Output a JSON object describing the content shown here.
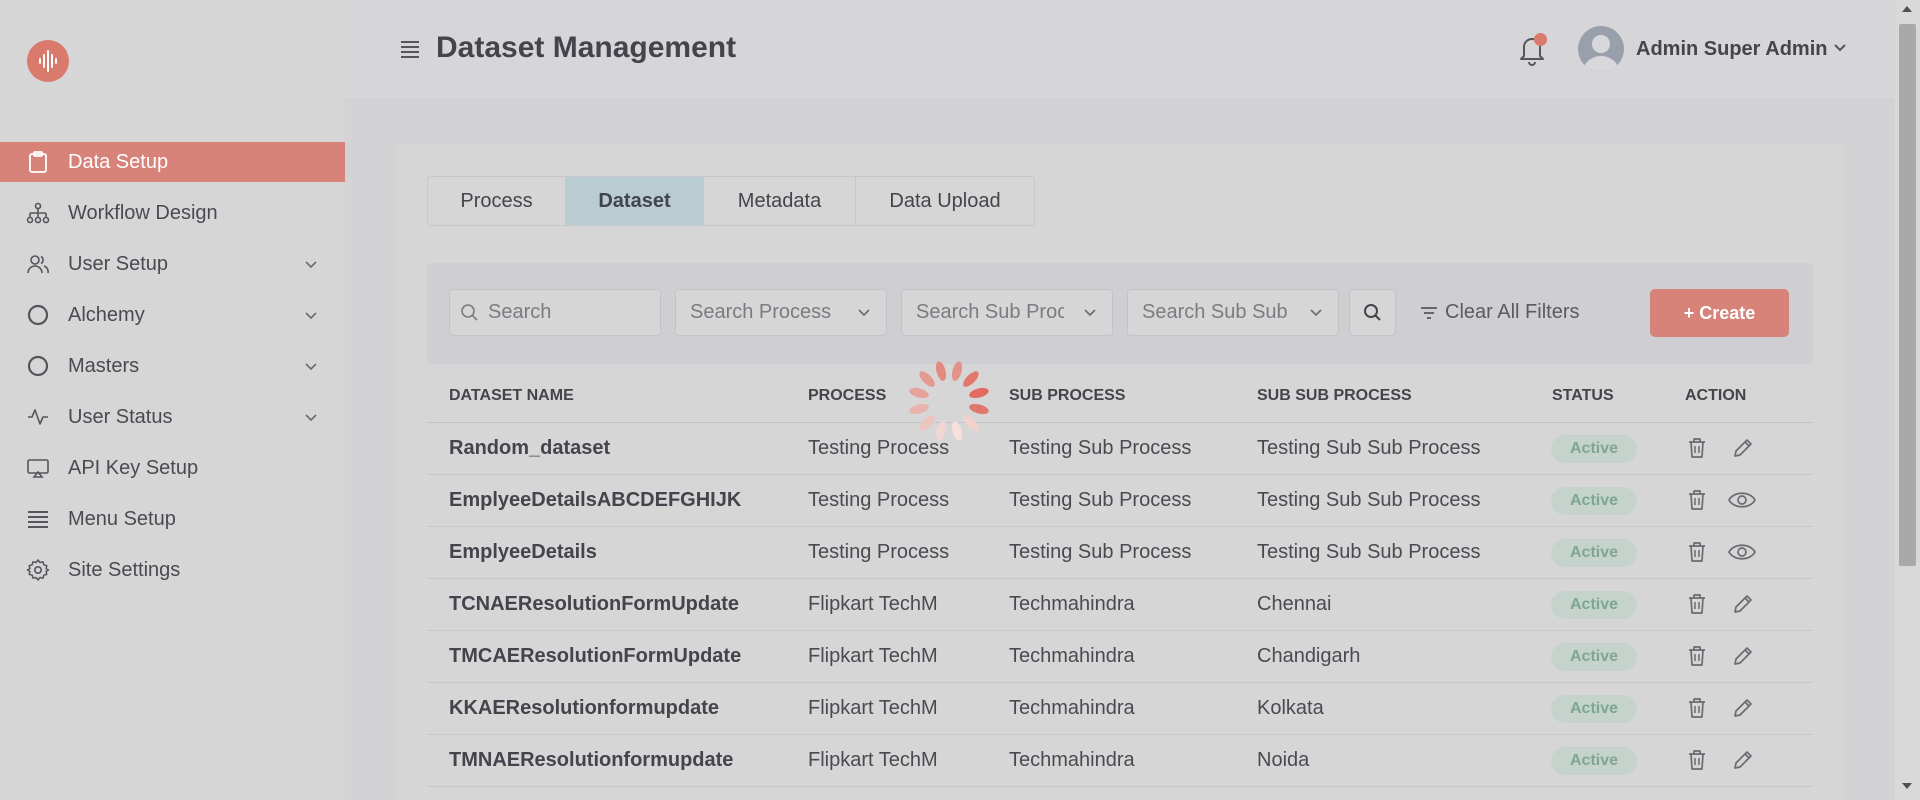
{
  "header": {
    "title": "Dataset Management",
    "user_name": "Admin Super Admin"
  },
  "sidebar": {
    "items": [
      {
        "label": "Data Setup",
        "icon": "clipboard-icon",
        "active": true,
        "expandable": false
      },
      {
        "label": "Workflow Design",
        "icon": "sitemap-icon",
        "active": false,
        "expandable": false
      },
      {
        "label": "User Setup",
        "icon": "users-icon",
        "active": false,
        "expandable": true
      },
      {
        "label": "Alchemy",
        "icon": "circle-icon",
        "active": false,
        "expandable": true
      },
      {
        "label": "Masters",
        "icon": "circle-icon",
        "active": false,
        "expandable": true
      },
      {
        "label": "User Status",
        "icon": "activity-icon",
        "active": false,
        "expandable": true
      },
      {
        "label": "API Key Setup",
        "icon": "monitor-icon",
        "active": false,
        "expandable": false
      },
      {
        "label": "Menu Setup",
        "icon": "list-icon",
        "active": false,
        "expandable": false
      },
      {
        "label": "Site Settings",
        "icon": "gear-icon",
        "active": false,
        "expandable": false
      }
    ]
  },
  "tabs": [
    {
      "label": "Process",
      "active": false
    },
    {
      "label": "Dataset",
      "active": true
    },
    {
      "label": "Metadata",
      "active": false
    },
    {
      "label": "Data Upload",
      "active": false
    }
  ],
  "filters": {
    "search_placeholder": "Search",
    "process_placeholder": "Search Process",
    "sub_process_placeholder": "Search Sub Proc",
    "sub_sub_process_placeholder": "Search Sub Sub",
    "clear_label": "Clear All Filters",
    "create_label": "+ Create"
  },
  "table": {
    "columns": [
      "DATASET NAME",
      "PROCESS",
      "SUB PROCESS",
      "SUB SUB PROCESS",
      "STATUS",
      "ACTION"
    ],
    "rows": [
      {
        "name": "Random_dataset",
        "process": "Testing Process",
        "sub_process": "Testing Sub Process",
        "sub_sub_process": "Testing Sub Sub Process",
        "status": "Active",
        "second_action": "edit"
      },
      {
        "name": "EmplyeeDetailsABCDEFGHIJK",
        "process": "Testing Process",
        "sub_process": "Testing Sub Process",
        "sub_sub_process": "Testing Sub Sub Process",
        "status": "Active",
        "second_action": "view"
      },
      {
        "name": "EmplyeeDetails",
        "process": "Testing Process",
        "sub_process": "Testing Sub Process",
        "sub_sub_process": "Testing Sub Sub Process",
        "status": "Active",
        "second_action": "view"
      },
      {
        "name": "TCNAEResolutionFormUpdate",
        "process": "Flipkart TechM",
        "sub_process": "Techmahindra",
        "sub_sub_process": "Chennai",
        "status": "Active",
        "second_action": "edit"
      },
      {
        "name": "TMCAEResolutionFormUpdate",
        "process": "Flipkart TechM",
        "sub_process": "Techmahindra",
        "sub_sub_process": "Chandigarh",
        "status": "Active",
        "second_action": "edit"
      },
      {
        "name": "KKAEResolutionformupdate",
        "process": "Flipkart TechM",
        "sub_process": "Techmahindra",
        "sub_sub_process": "Kolkata",
        "status": "Active",
        "second_action": "edit"
      },
      {
        "name": "TMNAEResolutionformupdate",
        "process": "Flipkart TechM",
        "sub_process": "Techmahindra",
        "sub_sub_process": "Noida",
        "status": "Active",
        "second_action": "edit"
      }
    ]
  },
  "colors": {
    "accent": "#d7837a",
    "active_tab": "#b9ccd1",
    "badge_bg": "#c5d3cc",
    "badge_text": "#7da792"
  }
}
